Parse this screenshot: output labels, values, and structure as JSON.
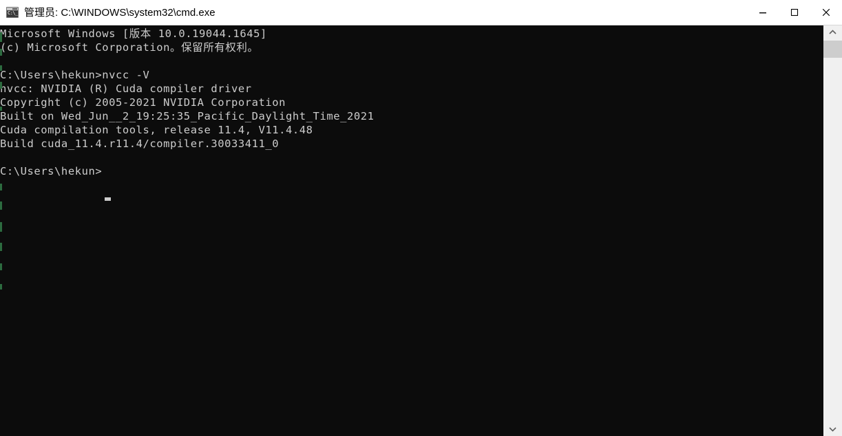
{
  "window": {
    "title": "管理员: C:\\WINDOWS\\system32\\cmd.exe",
    "icon": "cmd-icon",
    "icon_glyph": "C:\\_",
    "background_color": "#0c0c0c",
    "titlebar_color": "#ffffff",
    "text_color": "#cccccc"
  },
  "controls": {
    "minimize_label": "最小化",
    "maximize_label": "最大化",
    "close_label": "关闭"
  },
  "terminal": {
    "lines": [
      "Microsoft Windows [版本 10.0.19044.1645]",
      "(c) Microsoft Corporation。保留所有权利。",
      "",
      "C:\\Users\\hekun>nvcc -V",
      "nvcc: NVIDIA (R) Cuda compiler driver",
      "Copyright (c) 2005-2021 NVIDIA Corporation",
      "Built on Wed_Jun__2_19:25:35_Pacific_Daylight_Time_2021",
      "Cuda compilation tools, release 11.4, V11.4.48",
      "Build cuda_11.4.r11.4/compiler.30033411_0",
      "",
      "C:\\Users\\hekun>"
    ],
    "prompt": "C:\\Users\\hekun>",
    "command": "nvcc -V",
    "cursor": "block"
  },
  "scrollbar": {
    "up_arrow": "chevron-up-icon",
    "down_arrow": "chevron-down-icon",
    "thumb_position_percent": 2
  }
}
